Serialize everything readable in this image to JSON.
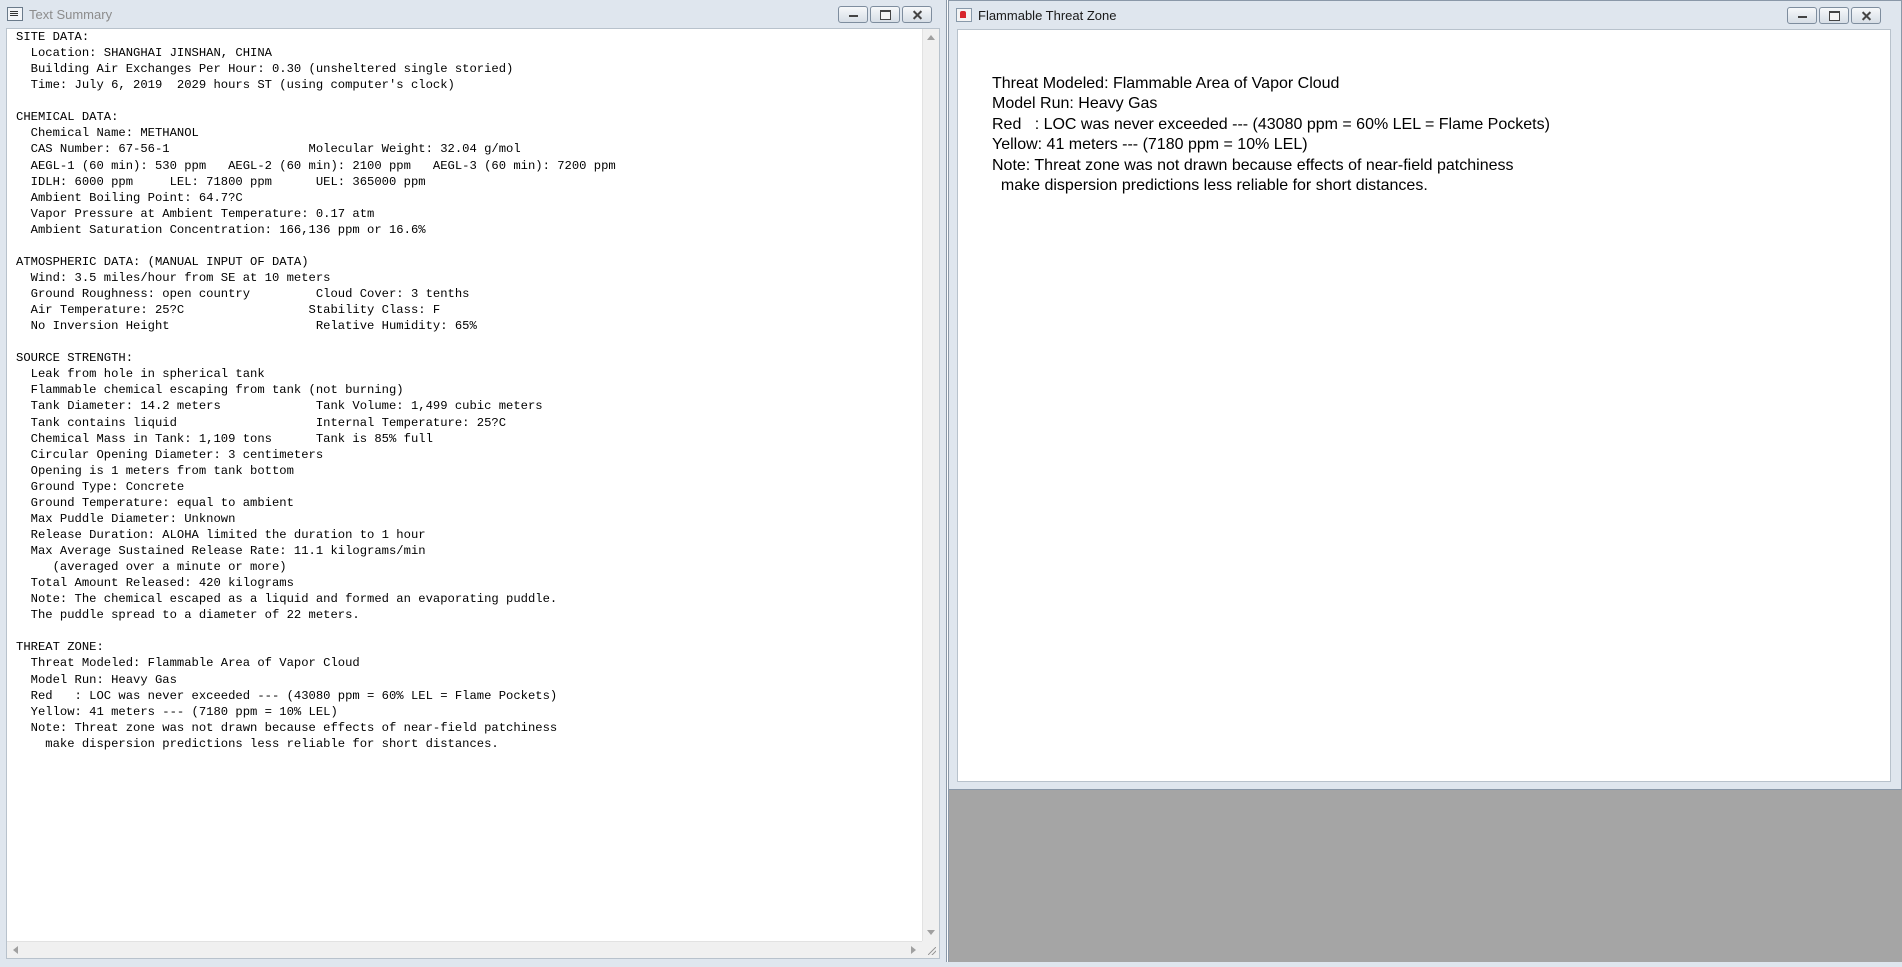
{
  "text_summary_window": {
    "title": "Text Summary",
    "icon": "text-document-icon",
    "lines": [
      "SITE DATA:",
      "  Location: SHANGHAI JINSHAN, CHINA",
      "  Building Air Exchanges Per Hour: 0.30 (unsheltered single storied)",
      "  Time: July 6, 2019  2029 hours ST (using computer's clock)",
      "",
      "CHEMICAL DATA:",
      "  Chemical Name: METHANOL",
      "  CAS Number: 67-56-1                   Molecular Weight: 32.04 g/mol",
      "  AEGL-1 (60 min): 530 ppm   AEGL-2 (60 min): 2100 ppm   AEGL-3 (60 min): 7200 ppm",
      "  IDLH: 6000 ppm     LEL: 71800 ppm      UEL: 365000 ppm",
      "  Ambient Boiling Point: 64.7?C",
      "  Vapor Pressure at Ambient Temperature: 0.17 atm",
      "  Ambient Saturation Concentration: 166,136 ppm or 16.6%",
      "",
      "ATMOSPHERIC DATA: (MANUAL INPUT OF DATA)",
      "  Wind: 3.5 miles/hour from SE at 10 meters",
      "  Ground Roughness: open country         Cloud Cover: 3 tenths",
      "  Air Temperature: 25?C                 Stability Class: F",
      "  No Inversion Height                    Relative Humidity: 65%",
      "",
      "SOURCE STRENGTH:",
      "  Leak from hole in spherical tank",
      "  Flammable chemical escaping from tank (not burning)",
      "  Tank Diameter: 14.2 meters             Tank Volume: 1,499 cubic meters",
      "  Tank contains liquid                   Internal Temperature: 25?C",
      "  Chemical Mass in Tank: 1,109 tons      Tank is 85% full",
      "  Circular Opening Diameter: 3 centimeters",
      "  Opening is 1 meters from tank bottom",
      "  Ground Type: Concrete",
      "  Ground Temperature: equal to ambient",
      "  Max Puddle Diameter: Unknown",
      "  Release Duration: ALOHA limited the duration to 1 hour",
      "  Max Average Sustained Release Rate: 11.1 kilograms/min",
      "     (averaged over a minute or more)",
      "  Total Amount Released: 420 kilograms",
      "  Note: The chemical escaped as a liquid and formed an evaporating puddle.",
      "  The puddle spread to a diameter of 22 meters.",
      "",
      "THREAT ZONE:",
      "  Threat Modeled: Flammable Area of Vapor Cloud",
      "  Model Run: Heavy Gas",
      "  Red   : LOC was never exceeded --- (43080 ppm = 60% LEL = Flame Pockets)",
      "  Yellow: 41 meters --- (7180 ppm = 10% LEL)",
      "  Note: Threat zone was not drawn because effects of near-field patchiness",
      "    make dispersion predictions less reliable for short distances."
    ]
  },
  "threat_zone_window": {
    "title": "Flammable Threat Zone",
    "icon": "aloha-app-icon",
    "lines": [
      "Threat Modeled: Flammable Area of Vapor Cloud",
      "Model Run: Heavy Gas",
      "Red   : LOC was never exceeded --- (43080 ppm = 60% LEL = Flame Pockets)",
      "Yellow: 41 meters --- (7180 ppm = 10% LEL)",
      "Note: Threat zone was not drawn because effects of near-field patchiness",
      "  make dispersion predictions less reliable for short distances."
    ]
  },
  "colors": {
    "titlebar": "#dfe6ee",
    "desktop": "#a5a5a5"
  }
}
